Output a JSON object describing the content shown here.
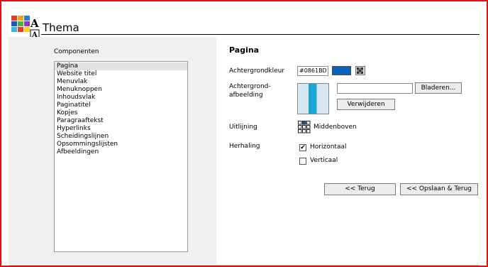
{
  "header": {
    "title": "Thema"
  },
  "sidebar": {
    "label": "Componenten",
    "items": [
      "Pagina",
      "Website titel",
      "Menuvlak",
      "Menuknoppen",
      "Inhoudsvlak",
      "Paginatitel",
      "Kopjes",
      "Paragraaftekst",
      "Hyperlinks",
      "Scheidingslijnen",
      "Opsommingslijsten",
      "Afbeeldingen"
    ],
    "selected": "Pagina"
  },
  "main": {
    "section_title": "Pagina",
    "background_color_label": "Achtergrondkleur",
    "background_color_value": "#0861BD",
    "background_image_label_line1": "Achtergrond-",
    "background_image_label_line2": "afbeelding",
    "file_path_value": "",
    "browse_label": "Bladeren...",
    "remove_label": "Verwijderen",
    "alignment_label": "Uitlijning",
    "alignment_value": "Middenboven",
    "repeat_label": "Herhaling",
    "horizontal_label": "Horizontaal",
    "horizontal_checked": true,
    "vertical_label": "Verticaal",
    "vertical_checked": false,
    "back_label": "<< Terug",
    "save_back_label": "<< Opslaan & Terug"
  },
  "colors": {
    "accent": "#0861BD",
    "frame_border": "#E01010",
    "panel_bg": "#F0F0F0"
  },
  "icons": {
    "logo": "theme-logo-icon",
    "picker": "color-picker-icon",
    "alignment": "alignment-grid-icon"
  }
}
